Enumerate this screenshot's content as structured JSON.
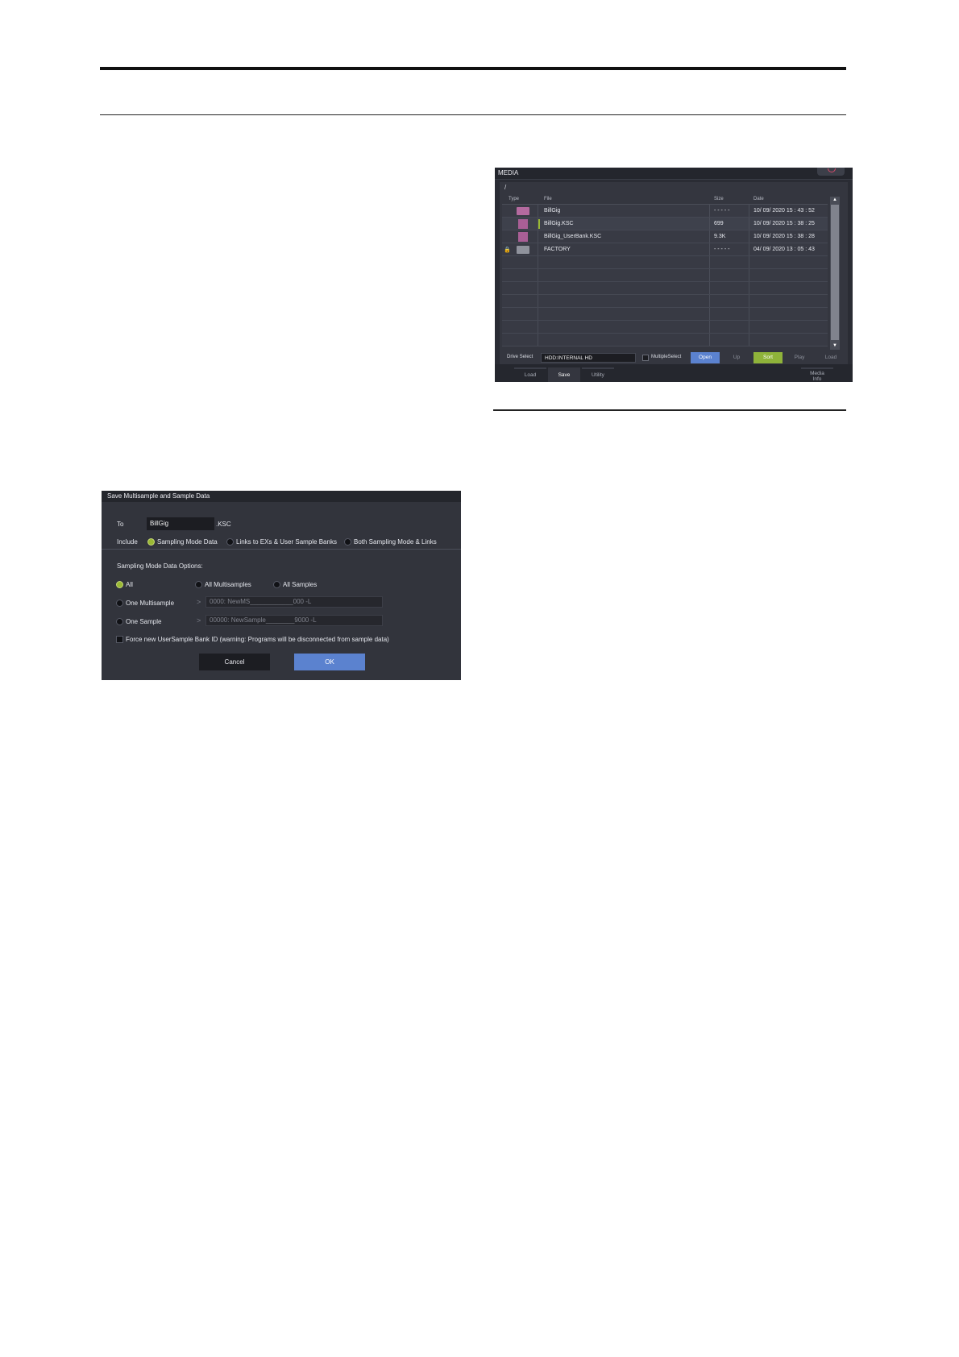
{
  "media": {
    "title": "MEDIA",
    "path": "/",
    "columns": {
      "type": "Type",
      "file": "File",
      "size": "Size",
      "date": "Date"
    },
    "files": [
      {
        "name": "BillGig",
        "size": "- - - - -",
        "date": "10/  09/  2020     15  :  43  :  52",
        "kind": "folder"
      },
      {
        "name": "BillGig.KSC",
        "size": "699",
        "date": "10/  09/  2020     15  :  38  :  25",
        "kind": "file"
      },
      {
        "name": "BillGig_UserBank.KSC",
        "size": "9.3K",
        "date": "10/  09/  2020     15  :  38  :  28",
        "kind": "file"
      },
      {
        "name": "FACTORY",
        "size": "- - - - -",
        "date": "04/  09/  2020     13  :  05  :  43",
        "kind": "folder-locked"
      }
    ],
    "drive_select_label": "Drive Select",
    "drive_value": "HDD:INTERNAL HD",
    "multiple_select_label": "MultipleSelect",
    "buttons": {
      "open": "Open",
      "up": "Up",
      "sort": "Sort",
      "play": "Play",
      "load": "Load"
    },
    "tabs": {
      "load": "Load",
      "save": "Save",
      "utility": "Utility",
      "media_info_1": "Media",
      "media_info_2": "Info"
    },
    "colors": {
      "open_button": "#5b82cf",
      "sort_button": "#8fb33a",
      "selection": "#9ab934"
    }
  },
  "dialog": {
    "title": "Save Multisample and Sample Data",
    "to_label": "To",
    "to_value": "BillGig",
    "extension": ".KSC",
    "include_label": "Include",
    "include_options": [
      "Sampling Mode Data",
      "Links to EXs & User Sample Banks",
      "Both Sampling Mode & Links"
    ],
    "include_selected": "Sampling Mode Data",
    "options_heading": "Sampling Mode Data Options:",
    "scope_options": [
      "All",
      "All Multisamples",
      "All Samples"
    ],
    "scope_selected": "All",
    "one_multisample_label": "One Multisample",
    "one_multisample_value": "0000: NewMS____________000 -L",
    "one_sample_label": "One Sample",
    "one_sample_value": "00000: NewSample________9000 -L",
    "force_label": "Force new UserSample Bank ID (warning: Programs will be disconnected from sample data)",
    "cancel": "Cancel",
    "ok": "OK"
  }
}
